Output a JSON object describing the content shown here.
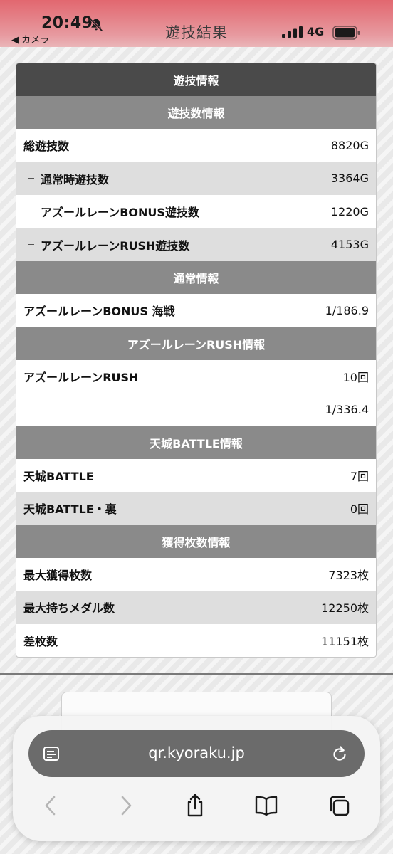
{
  "status_bar": {
    "time": "20:49",
    "back_label": "◀ カメラ",
    "title": "遊技結果",
    "network": "4G"
  },
  "panel": {
    "title": "遊技情報",
    "sections": [
      {
        "header": "遊技数情報",
        "rows": [
          {
            "label": "総遊技数",
            "value": "8820G",
            "sub": false
          },
          {
            "label": "通常時遊技数",
            "value": "3364G",
            "sub": true
          },
          {
            "label": "アズールレーンBONUS遊技数",
            "value": "1220G",
            "sub": true
          },
          {
            "label": "アズールレーンRUSH遊技数",
            "value": "4153G",
            "sub": true
          }
        ]
      },
      {
        "header": "通常情報",
        "rows": [
          {
            "label": "アズールレーンBONUS 海戦",
            "value": "1/186.9",
            "sub": false
          }
        ]
      },
      {
        "header": "アズールレーンRUSH情報",
        "rows": [
          {
            "label": "アズールレーンRUSH",
            "value": "10回",
            "sub": false
          },
          {
            "label": "",
            "value": "1/336.4",
            "sub": false
          }
        ]
      },
      {
        "header": "天城BATTLE情報",
        "rows": [
          {
            "label": "天城BATTLE",
            "value": "7回",
            "sub": false
          },
          {
            "label": "天城BATTLE・裏",
            "value": "0回",
            "sub": false
          }
        ]
      },
      {
        "header": "獲得枚数情報",
        "rows": [
          {
            "label": "最大獲得枚数",
            "value": "7323枚",
            "sub": false
          },
          {
            "label": "最大持ちメダル数",
            "value": "12250枚",
            "sub": false
          },
          {
            "label": "差枚数",
            "value": "11151枚",
            "sub": false
          }
        ]
      }
    ]
  },
  "browser": {
    "url": "qr.kyoraku.jp"
  },
  "colors": {
    "status_bar": "#e2676f",
    "panel_header": "#4a4a4a",
    "section_header": "#8a8a8a",
    "row_alt": "#dedede",
    "url_bar": "#6b6b6b"
  }
}
